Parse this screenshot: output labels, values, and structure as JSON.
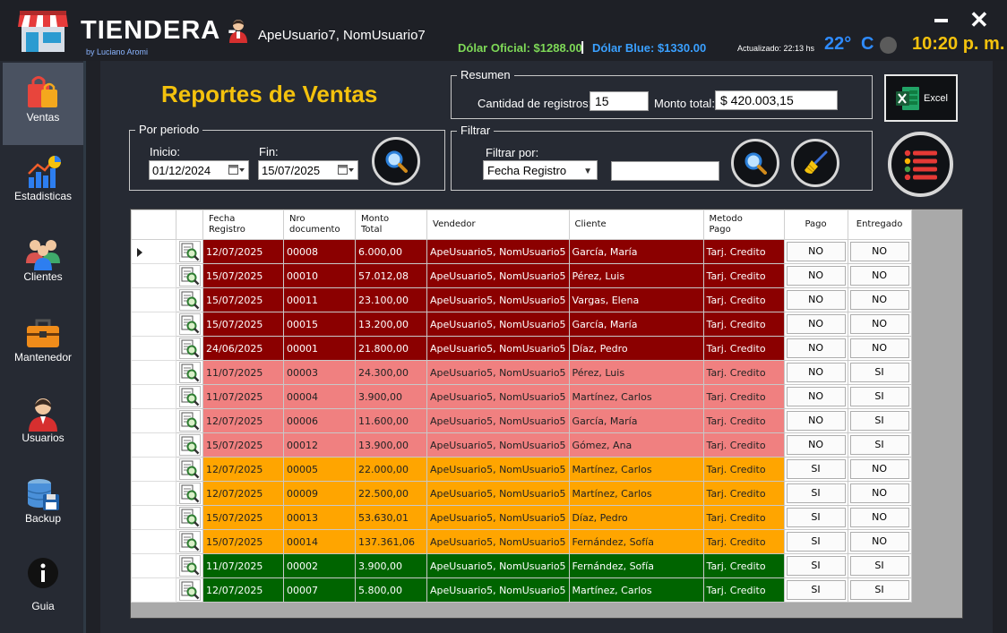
{
  "app": {
    "name": "TIENDERA -",
    "by": "by Luciano Aromi",
    "user": "ApeUsuario7, NomUsuario7"
  },
  "topbar": {
    "dolar_oficial": "Dólar Oficial: $1288.00",
    "separator": "|",
    "dolar_blue": "Dólar Blue: $1330.00",
    "updated": "Actualizado: 22:13 hs",
    "temperature": "22°",
    "temp_unit": "C",
    "clock": "10:20 p. m."
  },
  "sidebar": {
    "items": [
      {
        "label": "Ventas",
        "icon": "shopping-bag-icon"
      },
      {
        "label": "Estadisticas",
        "icon": "statistics-chart-icon"
      },
      {
        "label": "Clientes",
        "icon": "clients-group-icon"
      },
      {
        "label": "Mantenedor",
        "icon": "toolbox-icon"
      },
      {
        "label": "Usuarios",
        "icon": "user-icon"
      },
      {
        "label": "Backup",
        "icon": "database-backup-icon"
      },
      {
        "label": "Guia",
        "icon": "info-icon"
      }
    ]
  },
  "page": {
    "title": "Reportes de Ventas"
  },
  "resumen": {
    "title": "Resumen",
    "cantidad_label": "Cantidad de registros:",
    "cantidad_value": "15",
    "monto_label": "Monto total:",
    "monto_value": "$ 420.003,15"
  },
  "excel": {
    "label": "Excel"
  },
  "periodo": {
    "title": "Por periodo",
    "inicio_label": "Inicio:",
    "inicio_value": "01/12/2024",
    "fin_label": "Fin:",
    "fin_value": "15/07/2025"
  },
  "filtrar": {
    "title": "Filtrar",
    "filtrar_por_label": "Filtrar por:",
    "selected": "Fecha Registro",
    "search_value": ""
  },
  "grid": {
    "columns": [
      "Fecha\nRegistro",
      "Nro\ndocumento",
      "Monto\nTotal",
      "Vendedor",
      "Cliente",
      "Metodo\nPago",
      "Pago",
      "Entregado"
    ],
    "rows": [
      {
        "fecha": "12/07/2025",
        "nro": "00008",
        "monto": "6.000,00",
        "vendedor": "ApeUsuario5, NomUsuario5",
        "cliente": "García, María",
        "metodo": "Tarj. Credito",
        "pago": "NO",
        "entregado": "NO",
        "status": "dark"
      },
      {
        "fecha": "15/07/2025",
        "nro": "00010",
        "monto": "57.012,08",
        "vendedor": "ApeUsuario5, NomUsuario5",
        "cliente": "Pérez, Luis",
        "metodo": "Tarj. Credito",
        "pago": "NO",
        "entregado": "NO",
        "status": "dark"
      },
      {
        "fecha": "15/07/2025",
        "nro": "00011",
        "monto": "23.100,00",
        "vendedor": "ApeUsuario5, NomUsuario5",
        "cliente": "Vargas, Elena",
        "metodo": "Tarj. Credito",
        "pago": "NO",
        "entregado": "NO",
        "status": "dark"
      },
      {
        "fecha": "15/07/2025",
        "nro": "00015",
        "monto": "13.200,00",
        "vendedor": "ApeUsuario5, NomUsuario5",
        "cliente": "García, María",
        "metodo": "Tarj. Credito",
        "pago": "NO",
        "entregado": "NO",
        "status": "dark"
      },
      {
        "fecha": "24/06/2025",
        "nro": "00001",
        "monto": "21.800,00",
        "vendedor": "ApeUsuario5, NomUsuario5",
        "cliente": "Díaz, Pedro",
        "metodo": "Tarj. Credito",
        "pago": "NO",
        "entregado": "NO",
        "status": "dark"
      },
      {
        "fecha": "11/07/2025",
        "nro": "00003",
        "monto": "24.300,00",
        "vendedor": "ApeUsuario5, NomUsuario5",
        "cliente": "Pérez, Luis",
        "metodo": "Tarj. Credito",
        "pago": "NO",
        "entregado": "SI",
        "status": "pink"
      },
      {
        "fecha": "11/07/2025",
        "nro": "00004",
        "monto": "3.900,00",
        "vendedor": "ApeUsuario5, NomUsuario5",
        "cliente": "Martínez, Carlos",
        "metodo": "Tarj. Credito",
        "pago": "NO",
        "entregado": "SI",
        "status": "pink"
      },
      {
        "fecha": "12/07/2025",
        "nro": "00006",
        "monto": "11.600,00",
        "vendedor": "ApeUsuario5, NomUsuario5",
        "cliente": "García, María",
        "metodo": "Tarj. Credito",
        "pago": "NO",
        "entregado": "SI",
        "status": "pink"
      },
      {
        "fecha": "15/07/2025",
        "nro": "00012",
        "monto": "13.900,00",
        "vendedor": "ApeUsuario5, NomUsuario5",
        "cliente": "Gómez, Ana",
        "metodo": "Tarj. Credito",
        "pago": "NO",
        "entregado": "SI",
        "status": "pink"
      },
      {
        "fecha": "12/07/2025",
        "nro": "00005",
        "monto": "22.000,00",
        "vendedor": "ApeUsuario5, NomUsuario5",
        "cliente": "Martínez, Carlos",
        "metodo": "Tarj. Credito",
        "pago": "SI",
        "entregado": "NO",
        "status": "orange"
      },
      {
        "fecha": "12/07/2025",
        "nro": "00009",
        "monto": "22.500,00",
        "vendedor": "ApeUsuario5, NomUsuario5",
        "cliente": "Martínez, Carlos",
        "metodo": "Tarj. Credito",
        "pago": "SI",
        "entregado": "NO",
        "status": "orange"
      },
      {
        "fecha": "15/07/2025",
        "nro": "00013",
        "monto": "53.630,01",
        "vendedor": "ApeUsuario5, NomUsuario5",
        "cliente": "Díaz, Pedro",
        "metodo": "Tarj. Credito",
        "pago": "SI",
        "entregado": "NO",
        "status": "orange"
      },
      {
        "fecha": "15/07/2025",
        "nro": "00014",
        "monto": "137.361,06",
        "vendedor": "ApeUsuario5, NomUsuario5",
        "cliente": "Fernández, Sofía",
        "metodo": "Tarj. Credito",
        "pago": "SI",
        "entregado": "NO",
        "status": "orange"
      },
      {
        "fecha": "11/07/2025",
        "nro": "00002",
        "monto": "3.900,00",
        "vendedor": "ApeUsuario5, NomUsuario5",
        "cliente": "Fernández, Sofía",
        "metodo": "Tarj. Credito",
        "pago": "SI",
        "entregado": "SI",
        "status": "green"
      },
      {
        "fecha": "12/07/2025",
        "nro": "00007",
        "monto": "5.800,00",
        "vendedor": "ApeUsuario5, NomUsuario5",
        "cliente": "Martínez, Carlos",
        "metodo": "Tarj. Credito",
        "pago": "SI",
        "entregado": "SI",
        "status": "green"
      }
    ]
  },
  "colors": {
    "accent_yellow": "#f4c20d",
    "row_unpaid_undelivered": "#8b0000",
    "row_unpaid_delivered": "#f08080",
    "row_paid_undelivered": "#ffa500",
    "row_paid_delivered": "#006400"
  }
}
